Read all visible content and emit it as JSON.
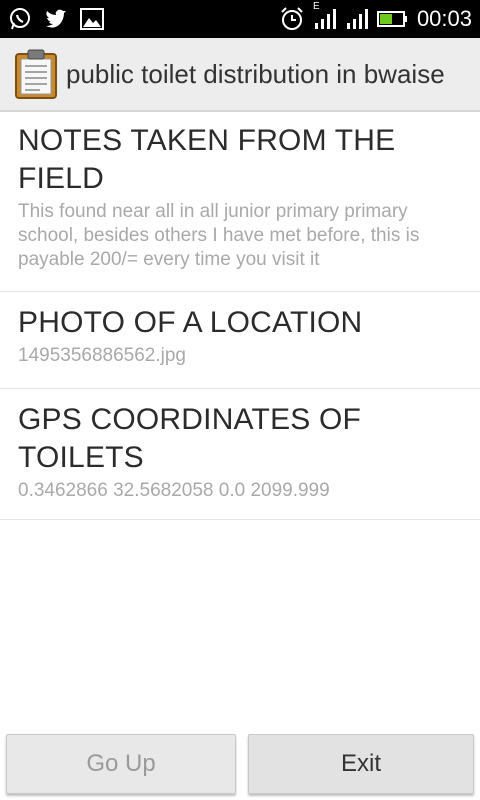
{
  "status_bar": {
    "time": "00:03",
    "network_type": "E",
    "icons": [
      "whatsapp-icon",
      "twitter-icon",
      "image-icon",
      "alarm-icon",
      "signal-icon",
      "signal-icon",
      "battery-icon"
    ]
  },
  "action_bar": {
    "title": "public toilet distribution in bwaise",
    "icon": "clipboard-icon"
  },
  "fields": [
    {
      "label": "NOTES TAKEN FROM THE FIELD",
      "value": "This  found  near  all in all junior  primary primary school,  besides  others I have met before,  this is payable 200/= every  time you visit it"
    },
    {
      "label": "PHOTO OF A LOCATION",
      "value": "1495356886562.jpg"
    },
    {
      "label": "GPS COORDINATES OF TOILETS",
      "value": "0.3462866 32.5682058 0.0 2099.999"
    }
  ],
  "buttons": {
    "go_up": "Go Up",
    "exit": "Exit"
  },
  "colors": {
    "status_bar_bg": "#000000",
    "action_bar_bg": "#ededed",
    "label_text": "#2b2b2b",
    "value_text": "#a9a9a9",
    "battery_green": "#6ecb1e"
  }
}
